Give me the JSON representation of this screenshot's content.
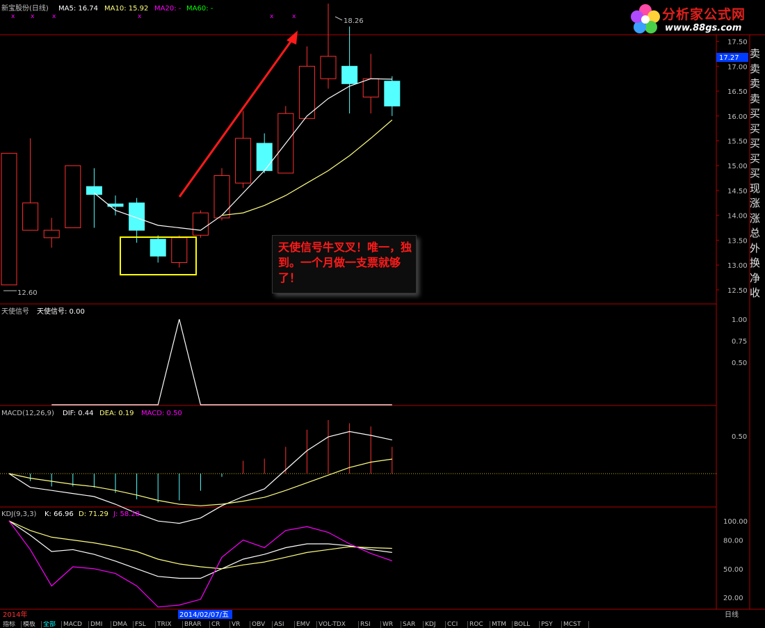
{
  "header": {
    "title": "新宝股份(日线)",
    "ma5_label": "MA5: 16.74",
    "ma10_label": "MA10: 15.92",
    "ma20_label": "MA20: -",
    "ma60_label": "MA60: -",
    "max_price_label": "18.26",
    "min_price_label": "12.60",
    "current_price": "17.27"
  },
  "logo": {
    "name": "分析家公式网",
    "url": "www.88gs.com"
  },
  "annotation": {
    "text": "天使信号牛叉叉！唯一，独到。一个月做一支票就够了！"
  },
  "colors": {
    "up": "#ff3030",
    "down": "#54ffff",
    "ma5": "#ffffff",
    "ma10": "#ffff80",
    "magenta": "#ff00ff",
    "green": "#00ff00",
    "grid": "#b00000"
  },
  "price_chart": {
    "yticks": [
      "17.50",
      "17.00",
      "16.50",
      "16.00",
      "15.50",
      "15.00",
      "14.50",
      "14.00",
      "13.50",
      "13.00",
      "12.50"
    ],
    "candles": [
      {
        "o": 12.6,
        "h": 15.25,
        "l": 12.6,
        "c": 15.25
      },
      {
        "o": 13.7,
        "h": 15.55,
        "l": 13.7,
        "c": 14.25
      },
      {
        "o": 13.55,
        "h": 13.95,
        "l": 13.35,
        "c": 13.7
      },
      {
        "o": 13.75,
        "h": 15.0,
        "l": 13.75,
        "c": 15.0
      },
      {
        "o": 14.58,
        "h": 14.95,
        "l": 13.75,
        "c": 14.42
      },
      {
        "o": 14.23,
        "h": 14.4,
        "l": 14.0,
        "c": 14.18
      },
      {
        "o": 14.25,
        "h": 14.35,
        "l": 13.45,
        "c": 13.7
      },
      {
        "o": 13.52,
        "h": 13.6,
        "l": 13.05,
        "c": 13.18
      },
      {
        "o": 13.05,
        "h": 13.6,
        "l": 12.95,
        "c": 13.55
      },
      {
        "o": 13.6,
        "h": 14.1,
        "l": 13.55,
        "c": 14.05
      },
      {
        "o": 13.95,
        "h": 14.95,
        "l": 13.9,
        "c": 14.8
      },
      {
        "o": 14.65,
        "h": 16.1,
        "l": 14.55,
        "c": 15.55
      },
      {
        "o": 15.45,
        "h": 15.65,
        "l": 14.85,
        "c": 14.9
      },
      {
        "o": 14.85,
        "h": 16.2,
        "l": 14.85,
        "c": 16.05
      },
      {
        "o": 15.95,
        "h": 17.4,
        "l": 15.95,
        "c": 17.0
      },
      {
        "o": 16.75,
        "h": 18.26,
        "l": 16.55,
        "c": 17.2
      },
      {
        "o": 17.0,
        "h": 17.8,
        "l": 16.05,
        "c": 16.65
      },
      {
        "o": 16.38,
        "h": 17.25,
        "l": 16.05,
        "c": 16.75
      },
      {
        "o": 16.7,
        "h": 16.8,
        "l": 16.0,
        "c": 16.2
      }
    ],
    "ma5": [
      null,
      null,
      null,
      null,
      14.45,
      14.1,
      13.95,
      13.8,
      13.75,
      13.7,
      14.0,
      14.45,
      14.9,
      15.45,
      16.0,
      16.35,
      16.6,
      16.75,
      16.74
    ],
    "ma10": [
      null,
      null,
      null,
      null,
      null,
      null,
      null,
      null,
      null,
      null,
      14.0,
      14.05,
      14.2,
      14.4,
      14.65,
      14.9,
      15.2,
      15.55,
      15.92
    ]
  },
  "angel_signal": {
    "title": "天使信号",
    "value_label": "天使信号: 0.00",
    "yticks": [
      "1.00",
      "0.75",
      "0.50"
    ],
    "values": [
      null,
      null,
      0,
      0,
      0,
      0,
      0,
      0,
      1,
      0,
      0,
      0,
      0,
      0,
      0,
      0,
      0,
      0,
      0
    ]
  },
  "macd": {
    "title": "MACD(12,26,9)",
    "dif_label": "DIF: 0.44",
    "dea_label": "DEA: 0.19",
    "macd_label": "MACD: 0.50",
    "yticks": [
      "0.50"
    ],
    "dif": [
      0.0,
      -0.18,
      -0.22,
      -0.26,
      -0.3,
      -0.4,
      -0.52,
      -0.62,
      -0.65,
      -0.58,
      -0.42,
      -0.3,
      -0.2,
      0.05,
      0.3,
      0.48,
      0.55,
      0.5,
      0.44
    ],
    "dea": [
      0.0,
      -0.06,
      -0.1,
      -0.14,
      -0.17,
      -0.22,
      -0.28,
      -0.35,
      -0.4,
      -0.42,
      -0.4,
      -0.36,
      -0.31,
      -0.22,
      -0.12,
      -0.02,
      0.08,
      0.15,
      0.19
    ],
    "bars": [
      0.0,
      -0.14,
      -0.24,
      -0.24,
      -0.26,
      -0.36,
      -0.48,
      -0.54,
      -0.5,
      -0.32,
      -0.06,
      0.24,
      0.28,
      0.5,
      0.82,
      1.0,
      0.94,
      0.88,
      0.5
    ]
  },
  "kdj": {
    "title": "KDJ(9,3,3)",
    "k_label": "K: 66.96",
    "d_label": "D: 71.29",
    "j_label": "J: 58.28",
    "yticks": [
      "100.00",
      "80.00",
      "50.00",
      "20.00"
    ],
    "k": [
      100,
      85,
      68,
      70,
      65,
      58,
      50,
      42,
      40,
      40,
      50,
      60,
      65,
      72,
      76,
      76,
      74,
      70,
      66.96
    ],
    "d": [
      100,
      90,
      83,
      80,
      77,
      73,
      68,
      60,
      55,
      52,
      50,
      54,
      57,
      62,
      67,
      70,
      73,
      72,
      71.29
    ],
    "j": [
      100,
      70,
      32,
      52,
      50,
      45,
      32,
      10,
      12,
      18,
      62,
      80,
      72,
      90,
      94,
      88,
      76,
      66,
      58.28
    ]
  },
  "date": {
    "year_label": "2014年",
    "cursor_date": "2014/02/07/五",
    "period_label": "日线"
  },
  "tabs": [
    "指标",
    "模板",
    "全部",
    "MACD",
    "DMI",
    "DMA",
    "FSL",
    "TRIX",
    "BRAR",
    "CR",
    "VR",
    "OBV",
    "ASI",
    "EMV",
    "VOL-TDX",
    "RSI",
    "WR",
    "SAR",
    "KDJ",
    "CCI",
    "ROC",
    "MTM",
    "BOLL",
    "PSY",
    "MCST"
  ],
  "sidebar": {
    "labels": [
      "卖",
      "卖",
      "卖",
      "卖",
      "买",
      "买",
      "买",
      "买",
      "买",
      "现",
      "涨",
      "涨",
      "总",
      "外",
      "换",
      "净",
      "收"
    ]
  }
}
